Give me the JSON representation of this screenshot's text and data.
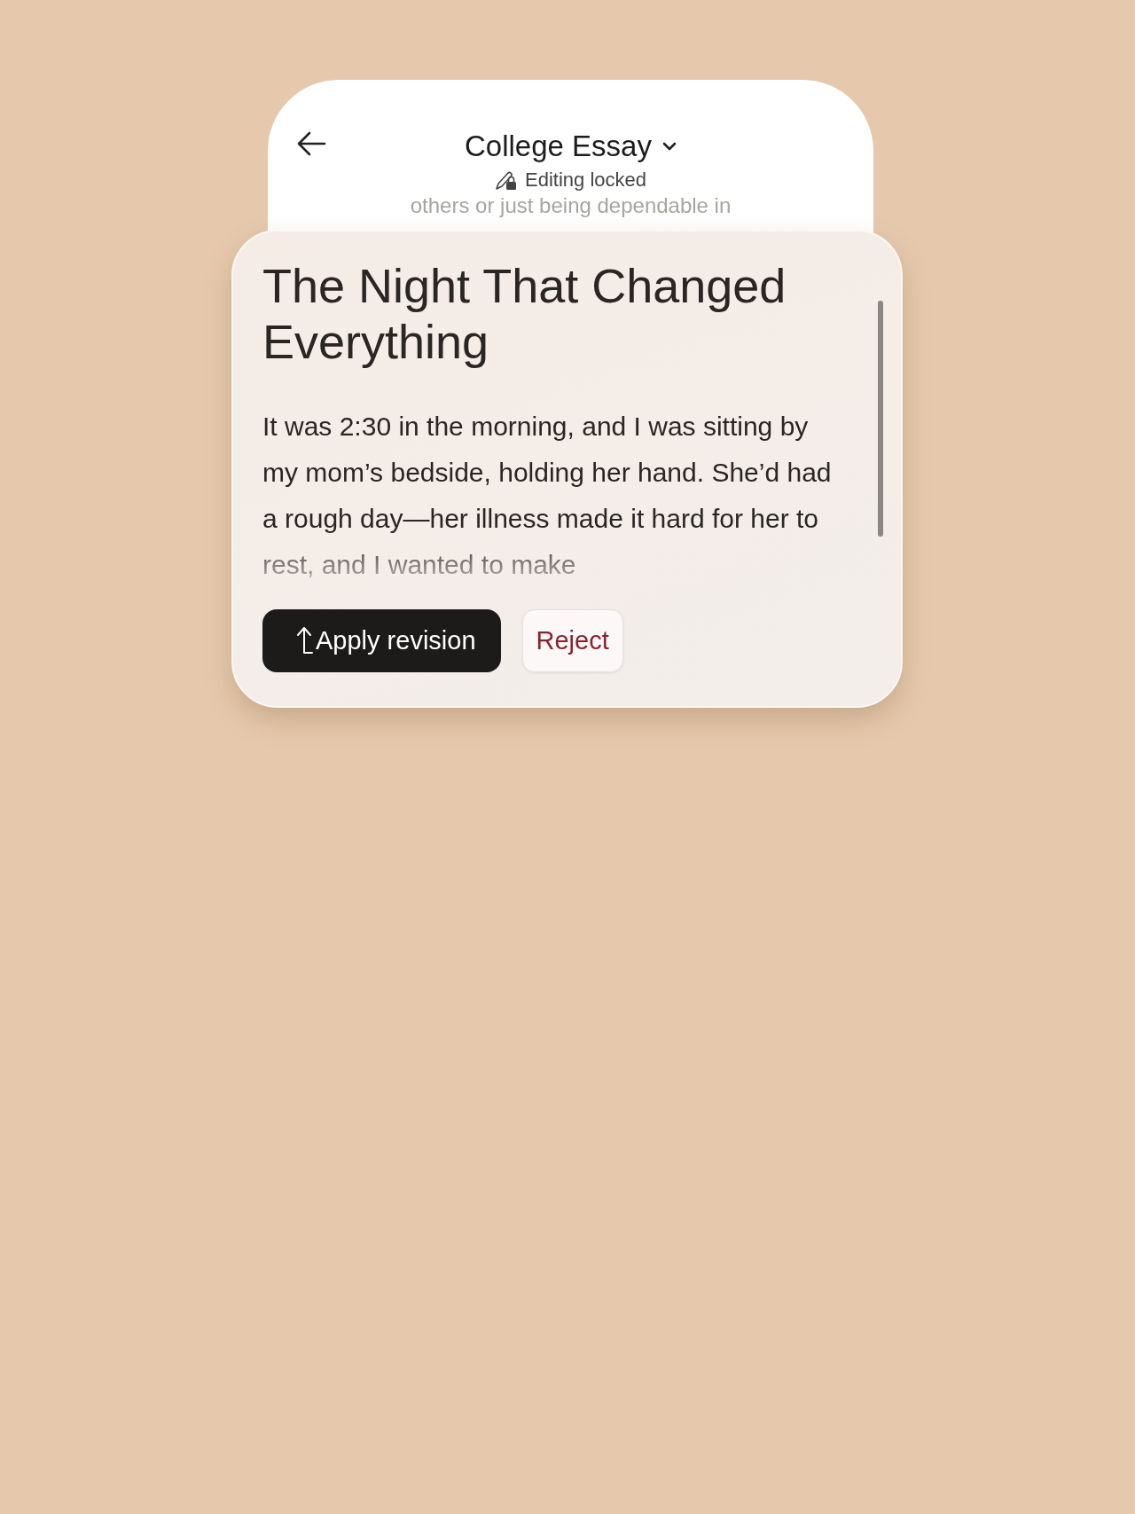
{
  "header": {
    "title": "College Essay",
    "status": "Editing locked",
    "behind_text": "others or just being dependable in"
  },
  "revision": {
    "title": "The Night That Changed Everything",
    "body": "It was 2:30 in the morning, and I was sitting by my mom’s bedside, holding her hand. She’d had a rough day—her illness made it hard for her to rest, and I wanted to make",
    "buttons": [
      {
        "kind": "primary",
        "label": "Apply revision"
      },
      {
        "kind": "secondary",
        "label": "Reject"
      }
    ]
  }
}
